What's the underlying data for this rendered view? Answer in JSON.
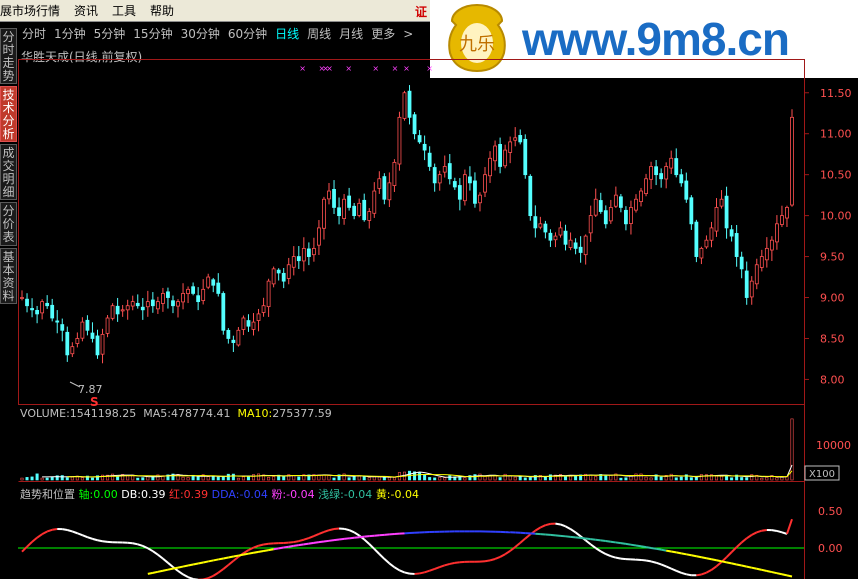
{
  "menu": {
    "items": [
      "展市场行情",
      "资讯",
      "工具",
      "帮助"
    ],
    "right_mark": "证"
  },
  "watermark": {
    "text": "www.9m8.cn",
    "logo_text": "九乐"
  },
  "sidebar": {
    "tabs": [
      {
        "label": "分时走势",
        "active": false
      },
      {
        "label": "技术分析",
        "active": true
      },
      {
        "label": "成交明细",
        "active": false
      },
      {
        "label": "分价表",
        "active": false
      },
      {
        "label": "基本资料",
        "active": false
      }
    ]
  },
  "periods": {
    "items": [
      {
        "label": "分时",
        "active": false
      },
      {
        "label": "1分钟",
        "active": false
      },
      {
        "label": "5分钟",
        "active": false
      },
      {
        "label": "15分钟",
        "active": false
      },
      {
        "label": "30分钟",
        "active": false
      },
      {
        "label": "60分钟",
        "active": false
      },
      {
        "label": "日线",
        "active": true
      },
      {
        "label": "周线",
        "active": false
      },
      {
        "label": "月线",
        "active": false
      },
      {
        "label": "更多",
        "active": false
      }
    ],
    "more_arrow": ">"
  },
  "chart_title": "华胜天成(日线,前复权)",
  "price_axis": {
    "ticks": [
      "11.50",
      "11.00",
      "10.50",
      "10.00",
      "9.50",
      "9.00",
      "8.50",
      "8.00"
    ],
    "ylim": [
      7.7,
      11.9
    ]
  },
  "low_marker": {
    "label": "7.87",
    "signal": "S"
  },
  "volume": {
    "label_vol": "VOLUME:",
    "vol": "1541198.25",
    "label_ma5": "MA5:",
    "ma5": "478774.41",
    "label_ma10": "MA10:",
    "ma10": "275377.59",
    "tick": "10000",
    "unit": "X100"
  },
  "indicator": {
    "name": "趋势和位置",
    "items": [
      {
        "label": "轴:",
        "value": "0.00",
        "color": "#00ff00"
      },
      {
        "label": "DB:",
        "value": "0.39",
        "color": "#ffffff"
      },
      {
        "label": "红:",
        "value": "0.39",
        "color": "#ff3030"
      },
      {
        "label": "DDA:",
        "value": "-0.04",
        "color": "#3040ff"
      },
      {
        "label": "粉:",
        "value": "-0.04",
        "color": "#ff40ff"
      },
      {
        "label": "浅绿:",
        "value": "-0.04",
        "color": "#30c0a0"
      },
      {
        "label": "黄:",
        "value": "-0.04",
        "color": "#ffff00"
      }
    ],
    "ticks": [
      "0.50",
      "0.00"
    ]
  },
  "colors": {
    "up": "#ff5050",
    "down": "#54ffff",
    "border": "#a01818",
    "axis_text": "#ff5050",
    "ma5": "#ffffff",
    "ma10": "#ffff00"
  },
  "chart_data": {
    "type": "candlestick",
    "title": "华胜天成(日线,前复权)",
    "ylim": [
      7.7,
      11.9
    ],
    "closes": [
      9.0,
      8.9,
      8.85,
      8.8,
      8.95,
      8.9,
      8.75,
      8.7,
      8.6,
      8.3,
      8.4,
      8.5,
      8.7,
      8.6,
      8.5,
      8.3,
      8.55,
      8.75,
      8.9,
      8.8,
      8.85,
      8.9,
      8.95,
      8.9,
      8.85,
      8.95,
      8.9,
      8.95,
      9.05,
      9.0,
      8.9,
      8.95,
      9.05,
      9.1,
      9.05,
      8.95,
      9.1,
      9.25,
      9.15,
      9.05,
      8.6,
      8.5,
      8.45,
      8.6,
      8.75,
      8.65,
      8.7,
      8.8,
      8.9,
      9.2,
      9.35,
      9.3,
      9.2,
      9.4,
      9.5,
      9.45,
      9.6,
      9.5,
      9.6,
      9.85,
      10.2,
      10.3,
      10.1,
      10.0,
      10.2,
      10.1,
      10.0,
      10.15,
      9.95,
      10.05,
      10.3,
      10.45,
      10.2,
      10.4,
      10.65,
      11.2,
      11.5,
      11.2,
      11.0,
      10.9,
      10.8,
      10.6,
      10.4,
      10.5,
      10.6,
      10.45,
      10.35,
      10.2,
      10.5,
      10.4,
      10.15,
      10.25,
      10.5,
      10.7,
      10.85,
      10.6,
      10.8,
      10.9,
      10.95,
      10.9,
      10.5,
      10.0,
      9.85,
      9.9,
      9.8,
      9.7,
      9.75,
      9.85,
      9.65,
      9.7,
      9.6,
      9.55,
      9.75,
      10.0,
      10.2,
      10.05,
      9.9,
      10.1,
      10.25,
      10.1,
      9.9,
      10.1,
      10.2,
      10.3,
      10.45,
      10.6,
      10.5,
      10.45,
      10.6,
      10.7,
      10.5,
      10.4,
      10.2,
      9.9,
      9.5,
      9.6,
      9.7,
      9.85,
      10.1,
      10.2,
      9.85,
      9.75,
      9.5,
      9.35,
      9.0,
      9.2,
      9.4,
      9.5,
      9.6,
      9.7,
      9.9,
      10.0,
      10.1,
      11.2
    ]
  }
}
